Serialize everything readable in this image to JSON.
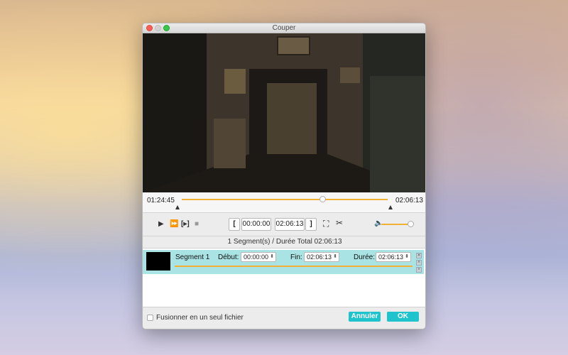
{
  "window": {
    "title": "Couper"
  },
  "player": {
    "current_time": "01:24:45",
    "total_time": "02:06:13",
    "progress": 0.67,
    "start_box": "00:00:00",
    "end_box": "02:06:13",
    "volume": 1.0
  },
  "summary": "1 Segment(s) / Durée Total 02:06:13",
  "segment": {
    "name": "Segment 1",
    "start_label": "Début:",
    "start_value": "00:00:00",
    "end_label": "Fin:",
    "end_value": "02:06:13",
    "duration_label": "Durée:",
    "duration_value": "02:06:13"
  },
  "footer": {
    "merge_label": "Fusionner en un seul fichier",
    "cancel_label": "Annuler",
    "ok_label": "OK"
  },
  "colors": {
    "accent": "#1fc3cc",
    "track": "#f2b136",
    "segment_bg": "#a9e3e3"
  }
}
